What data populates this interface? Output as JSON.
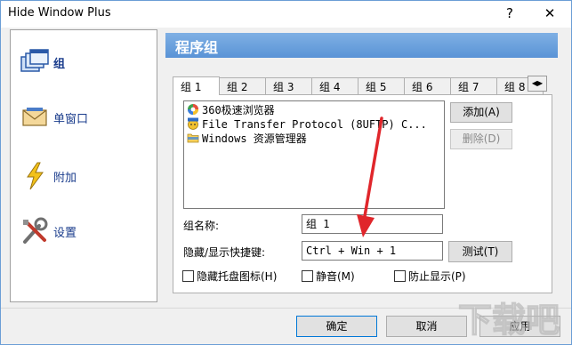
{
  "window": {
    "title": "Hide Window Plus",
    "help": "?",
    "close": "✕"
  },
  "sidebar": {
    "items": [
      {
        "label": "组"
      },
      {
        "label": "单窗口"
      },
      {
        "label": "附加"
      },
      {
        "label": "设置"
      }
    ]
  },
  "panel": {
    "title": "程序组"
  },
  "tabs": [
    {
      "label": "组 1"
    },
    {
      "label": "组 2"
    },
    {
      "label": "组 3"
    },
    {
      "label": "组 4"
    },
    {
      "label": "组 5"
    },
    {
      "label": "组 6"
    },
    {
      "label": "组 7"
    },
    {
      "label": "组 8"
    }
  ],
  "tab_scroll": {
    "left": "◀",
    "right": "▶"
  },
  "program_list": [
    {
      "label": "360极速浏览器",
      "icon": "browser-360-icon"
    },
    {
      "label": "File Transfer Protocol (8UFTP) C...",
      "icon": "ftp-icon"
    },
    {
      "label": "Windows 资源管理器",
      "icon": "explorer-folder-icon"
    }
  ],
  "buttons": {
    "add": "添加(A)",
    "delete": "删除(D)",
    "test": "测试(T)",
    "ok": "确定",
    "cancel": "取消",
    "apply": "应用"
  },
  "form": {
    "group_name_label": "组名称:",
    "group_name_value": "组 1",
    "hotkey_label": "隐藏/显示快捷键:",
    "hotkey_value": "Ctrl + Win + 1"
  },
  "checkboxes": {
    "hide_tray": "隐藏托盘图标(H)",
    "mute": "静音(M)",
    "prevent_show": "防止显示(P)"
  },
  "watermark": "下载吧",
  "colors": {
    "accent": "#5a93d6",
    "annotation_arrow": "#e0262b"
  }
}
